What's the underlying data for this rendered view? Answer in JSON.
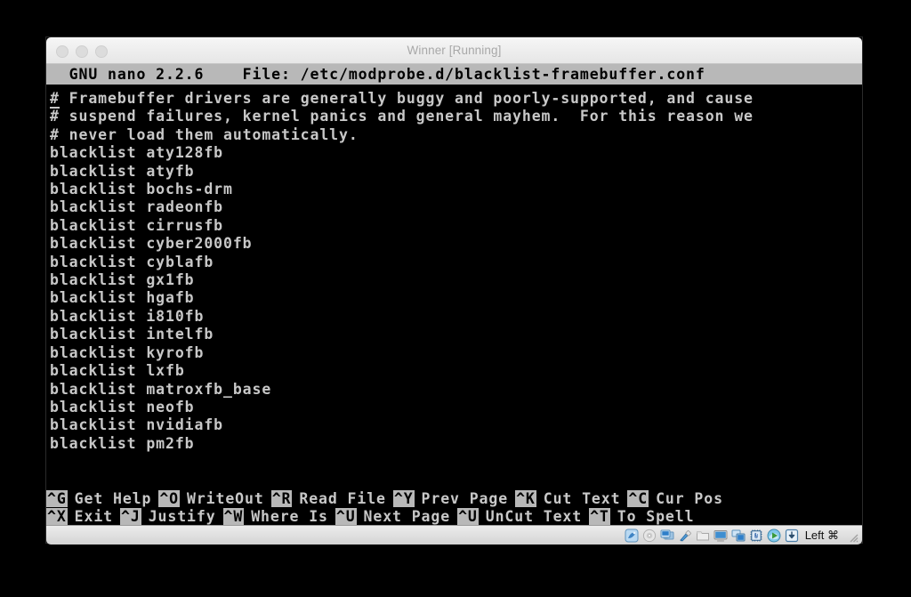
{
  "window": {
    "title": "Winner [Running]",
    "traffic_lights": [
      "close",
      "minimize",
      "zoom"
    ]
  },
  "nano": {
    "header": "  GNU nano 2.2.6    File: /etc/modprobe.d/blacklist-framebuffer.conf",
    "version": "GNU nano 2.2.6",
    "file_label": "File:",
    "file_path": "/etc/modprobe.d/blacklist-framebuffer.conf",
    "cursor_char": "#",
    "lines": [
      "# Framebuffer drivers are generally buggy and poorly-supported, and cause",
      "# suspend failures, kernel panics and general mayhem.  For this reason we",
      "# never load them automatically.",
      "blacklist aty128fb",
      "blacklist atyfb",
      "blacklist bochs-drm",
      "blacklist radeonfb",
      "blacklist cirrusfb",
      "blacklist cyber2000fb",
      "blacklist cyblafb",
      "blacklist gx1fb",
      "blacklist hgafb",
      "blacklist i810fb",
      "blacklist intelfb",
      "blacklist kyrofb",
      "blacklist lxfb",
      "blacklist matroxfb_base",
      "blacklist neofb",
      "blacklist nvidiafb",
      "blacklist pm2fb"
    ],
    "shortcuts_row1": [
      {
        "key": "^G",
        "label": "Get Help"
      },
      {
        "key": "^O",
        "label": "WriteOut"
      },
      {
        "key": "^R",
        "label": "Read File"
      },
      {
        "key": "^Y",
        "label": "Prev Page"
      },
      {
        "key": "^K",
        "label": "Cut Text"
      },
      {
        "key": "^C",
        "label": "Cur Pos"
      }
    ],
    "shortcuts_row2": [
      {
        "key": "^X",
        "label": "Exit"
      },
      {
        "key": "^J",
        "label": "Justify"
      },
      {
        "key": "^W",
        "label": "Where Is"
      },
      {
        "key": "^U",
        "label": "Next Page"
      },
      {
        "key": "^U",
        "label": "UnCut Text"
      },
      {
        "key": "^T",
        "label": "To Spell"
      }
    ]
  },
  "statusbar": {
    "icons": [
      "hard-disk-icon",
      "optical-disk-icon",
      "network-icon",
      "usb-icon",
      "shared-folder-icon",
      "display-icon",
      "video-capture-icon",
      "cpu-icon",
      "guest-additions-icon",
      "host-key-icon"
    ],
    "host_key": "Left ⌘",
    "resize_grip": "resize-grip"
  },
  "colors": {
    "terminal_background": "#000000",
    "terminal_foreground": "#c8c8c8",
    "nano_bar_background": "#b8b8b8",
    "nano_bar_foreground": "#000000",
    "titlebar_text": "#a8a8a8"
  }
}
